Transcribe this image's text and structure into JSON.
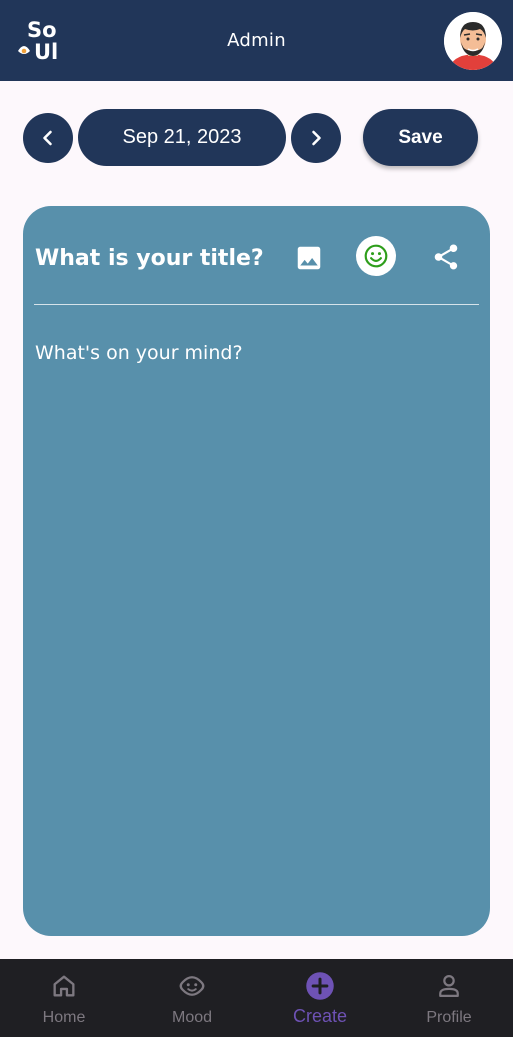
{
  "app_bar": {
    "logo_text": "SoUl",
    "title": "Admin",
    "avatar_icon": "user-avatar",
    "background": "#213659"
  },
  "date_bar": {
    "prev_icon": "chevron-left-icon",
    "date": "Sep 21, 2023",
    "next_icon": "chevron-right-icon",
    "save_label": "Save"
  },
  "editor": {
    "title_placeholder": "What is your title?",
    "body_placeholder": "What's on your mind?",
    "tools": [
      "image-icon",
      "emoji-icon",
      "share-icon"
    ],
    "card_color": "#5890ab",
    "emoji_color": "#2e9e1b"
  },
  "bottom_nav": {
    "items": [
      {
        "label": "Home",
        "icon": "home-icon"
      },
      {
        "label": "Mood",
        "icon": "mood-icon"
      },
      {
        "label": "Create",
        "icon": "add-circle-icon",
        "active": true
      },
      {
        "label": "Profile",
        "icon": "profile-icon"
      }
    ],
    "active_color": "#6e52b5"
  }
}
